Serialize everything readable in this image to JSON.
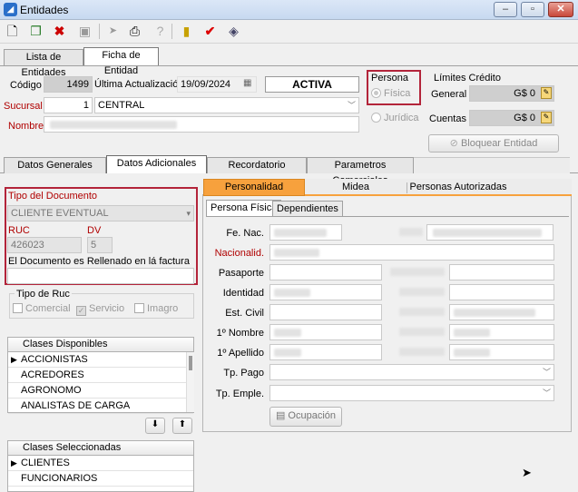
{
  "window": {
    "title": "Entidades",
    "controls": [
      "–",
      "▫",
      "✕"
    ]
  },
  "toolbar": {
    "icons": [
      "new-icon",
      "copy-icon",
      "delete-icon",
      "save-icon",
      "arrow-icon",
      "print-icon",
      "help-icon",
      "exit-icon",
      "check-icon",
      "eraser-icon"
    ]
  },
  "main_tabs": [
    "Lista de Entidades",
    "Ficha de Entidad"
  ],
  "header": {
    "codigo_label": "Código",
    "codigo_value": "1499",
    "ultima_label": "Última Actualización",
    "ultima_value": "19/09/2024",
    "status": "ACTIVA",
    "sucursal_label": "Sucursal",
    "sucursal_num": "1",
    "sucursal_name": "CENTRAL",
    "nombre_label": "Nombre"
  },
  "persona": {
    "title": "Persona",
    "fisica": "Física",
    "juridica": "Jurídica"
  },
  "limites": {
    "title": "Límites Crédito",
    "general_label": "General",
    "general_value": "G$ 0",
    "cuentas_label": "Cuentas",
    "cuentas_value": "G$ 0",
    "bloquear": "Bloquear Entidad"
  },
  "section_tabs": [
    "Datos Generales",
    "Datos Adicionales",
    "Recordatorio",
    "Parametros Comerciales"
  ],
  "documento": {
    "tipo_label": "Tipo del Documento",
    "tipo_value": "CLIENTE EVENTUAL",
    "ruc_label": "RUC",
    "ruc_value": "426023",
    "dv_label": "DV",
    "dv_value": "5",
    "rellenado_label": "El Documento es Rellenado en lá factura"
  },
  "tipo_ruc": {
    "title": "Tipo de Ruc",
    "comercial": "Comercial",
    "servicio": "Servicio",
    "imagro": "Imagro"
  },
  "clases_disponibles": {
    "header": "Clases Disponibles",
    "rows": [
      "ACCIONISTAS",
      "ACREDORES",
      "AGRONOMO",
      "ANALISTAS DE CARGA"
    ]
  },
  "clases_seleccionadas": {
    "header": "Clases Seleccionadas",
    "rows": [
      "CLIENTES",
      "FUNCIONARIOS"
    ]
  },
  "right_tabs": [
    "Personalidad",
    "Midea",
    "Personas Autorizadas"
  ],
  "sub_tabs": [
    "Persona Física",
    "Dependientes"
  ],
  "persona_fisica": {
    "fe_nac": "Fe. Nac.",
    "nacionalid": "Nacionalid.",
    "pasaporte": "Pasaporte",
    "identidad": "Identidad",
    "est_civil": "Est. Civil",
    "primer_nombre": "1º Nombre",
    "primer_apellido": "1º Apellido",
    "tp_pago": "Tp. Pago",
    "tp_emple": "Tp. Emple.",
    "ocupacion": "Ocupación"
  }
}
